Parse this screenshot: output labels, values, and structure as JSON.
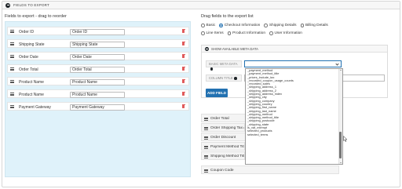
{
  "panel": {
    "title": "FIELDS TO EXPORT"
  },
  "left": {
    "title": "Fields to export - drag to reorder",
    "fields": [
      {
        "label": "Order ID",
        "value": "Order ID"
      },
      {
        "label": "Shipping State",
        "value": "Shipping State"
      },
      {
        "label": "Order Date",
        "value": "Order Date"
      },
      {
        "label": "Order Total",
        "value": "Order Total"
      },
      {
        "label": "Product Name",
        "value": "Product Name"
      },
      {
        "label": "Product Name",
        "value": "Product Name"
      },
      {
        "label": "Payment Gateway",
        "value": "Payment Gateway"
      }
    ]
  },
  "right": {
    "title": "Drag fields to the export list",
    "radios": [
      {
        "label": "Basic",
        "checked": false
      },
      {
        "label": "Checkout Information",
        "checked": true
      },
      {
        "label": "Shipping Details",
        "checked": false
      },
      {
        "label": "Billing Details",
        "checked": false
      },
      {
        "label": "Line Items",
        "checked": false
      },
      {
        "label": "Product Information",
        "checked": false
      },
      {
        "label": "User Information",
        "checked": false
      }
    ],
    "meta_box": {
      "title": "SHOW AVAILABLE META DATA",
      "meta_label": "BASIC META DATA",
      "column_title_label": "COLUMN TITLE",
      "column_title_value": "E",
      "add_button": "ADD FIELD"
    },
    "dropdown_options": [
      "_payment_method",
      "_payment_method_title",
      "_prices_include_tax",
      "_recorded_coupon_usage_counts",
      "_recorded_sales",
      "_shipping_address_1",
      "_shipping_address_2",
      "_shipping_address_index",
      "_shipping_city",
      "_shipping_company",
      "_shipping_country",
      "_shipping_first_name",
      "_shipping_last_name",
      "_shipping_method",
      "_shipping_method_title",
      "_shipping_postcode",
      "_shipping_state",
      "is_vat_exempt",
      "selected_products",
      "selected_terms"
    ],
    "export_items": [
      "Order Total",
      "Order Shipping Tax Amount",
      "Order Discount",
      "Payment Method Title",
      "Shipping Method Title",
      "Coupon Code"
    ]
  },
  "colors": {
    "accent": "#2271b1",
    "drop_area": "#dff2fa",
    "danger": "#e05b5b"
  }
}
